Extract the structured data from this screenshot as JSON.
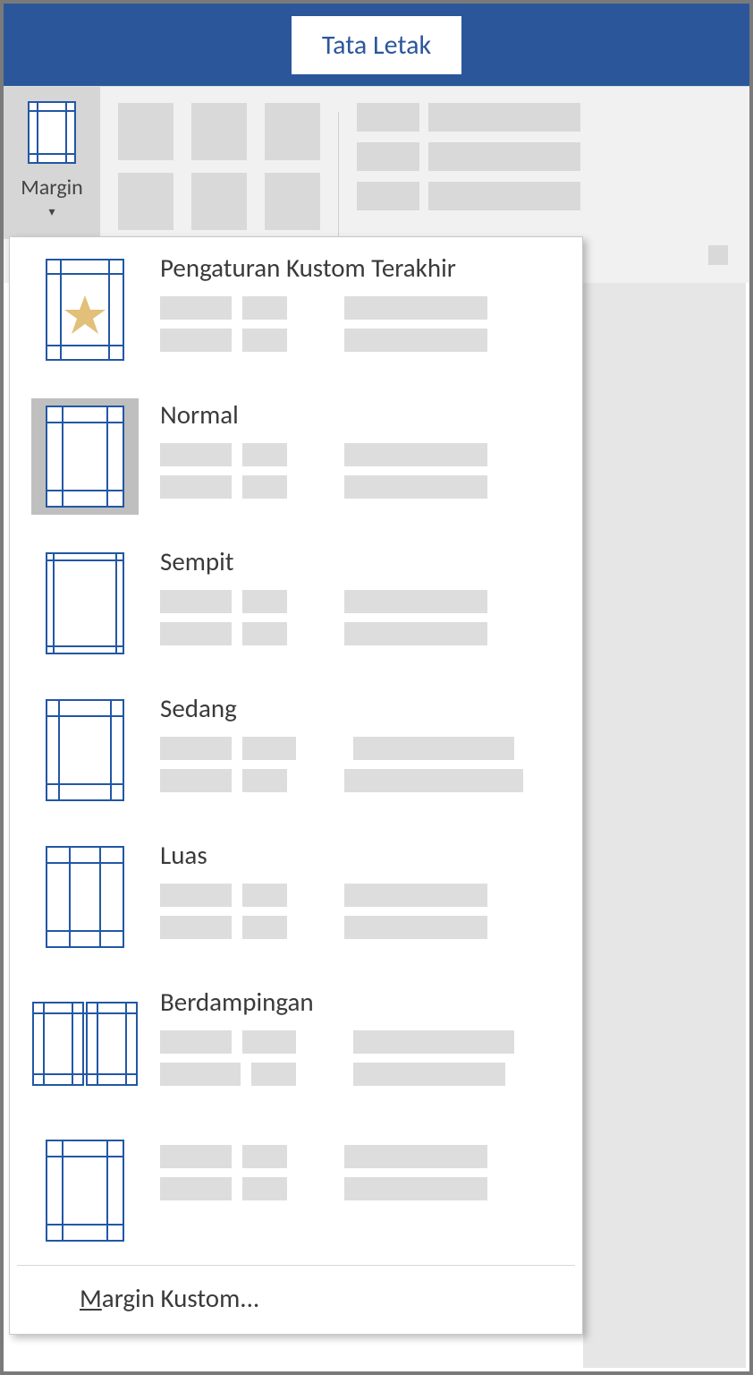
{
  "tab": {
    "active_label": "Tata Letak"
  },
  "ribbon": {
    "margins_button": {
      "label": "Margin"
    }
  },
  "margins_menu": {
    "items": [
      {
        "title": "Pengaturan Kustom Terakhir",
        "icon": "last-custom"
      },
      {
        "title": "Normal",
        "icon": "normal",
        "selected": true
      },
      {
        "title": "Sempit",
        "icon": "narrow"
      },
      {
        "title": "Sedang",
        "icon": "moderate"
      },
      {
        "title": "Luas",
        "icon": "wide"
      },
      {
        "title": "Berdampingan",
        "icon": "mirrored"
      },
      {
        "title": "",
        "icon": "office2003"
      }
    ],
    "custom_label_prefix": "M",
    "custom_label_rest": "argin Kustom..."
  }
}
